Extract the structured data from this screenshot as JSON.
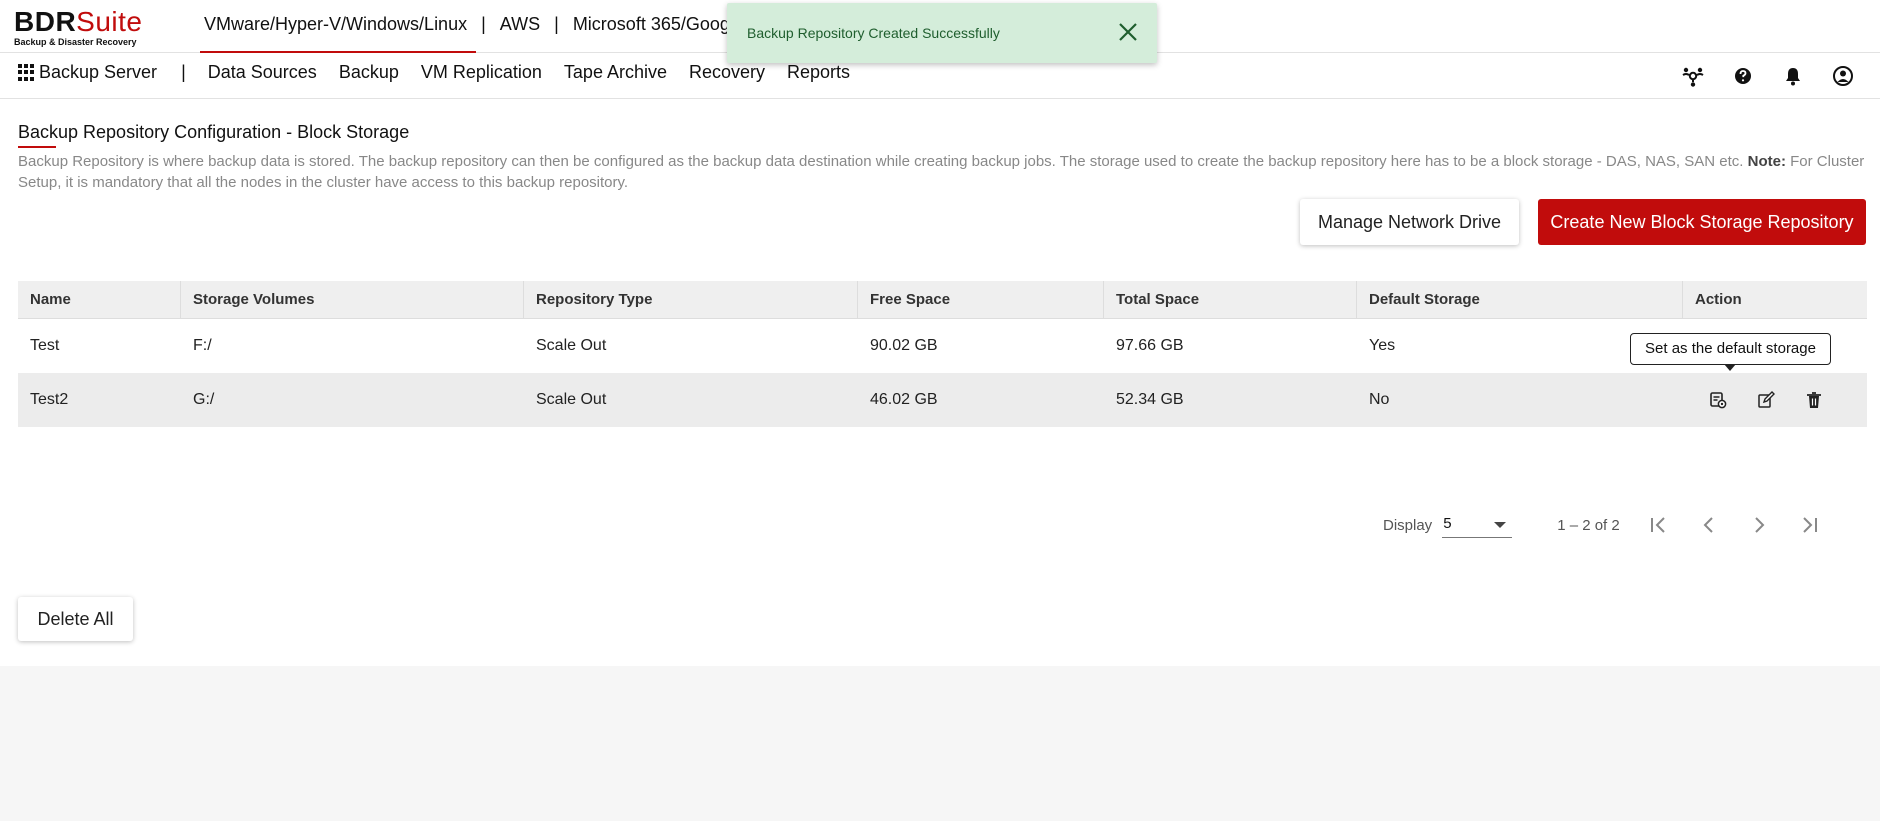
{
  "brand": {
    "name_part1": "BDR",
    "name_part2": "Suite",
    "tagline": "Backup & Disaster Recovery",
    "accent_color": "#c10c0c"
  },
  "product_tabs": [
    {
      "label": "VMware/Hyper-V/Windows/Linux",
      "active": true
    },
    {
      "label": "AWS"
    },
    {
      "label": "Microsoft 365/Goog"
    }
  ],
  "separators": {
    "pipe": "|"
  },
  "navbar": {
    "apps_icon": "grid-apps-icon",
    "server_label": "Backup Server",
    "items": [
      "Data Sources",
      "Backup",
      "VM Replication",
      "Tape Archive",
      "Recovery",
      "Reports"
    ],
    "right_icons": [
      "users-network-icon",
      "help-icon",
      "bell-icon",
      "user-account-icon"
    ]
  },
  "toast": {
    "message": "Backup Repository Created Successfully",
    "bg_color": "#d4edda"
  },
  "page": {
    "title": "Backup Repository Configuration - Block Storage",
    "description": "Backup Repository is where backup data is stored. The backup repository can then be configured as the backup data destination while creating backup jobs. The storage used to create the backup repository here has to be a block storage - DAS, NAS, SAN etc.",
    "note_label": "Note:",
    "note_text": "For Cluster Setup, it is mandatory that all the nodes in the cluster have access to this backup repository."
  },
  "buttons": {
    "manage_network_drive": "Manage Network Drive",
    "create_new": "Create New Block Storage Repository",
    "delete_all": "Delete All"
  },
  "table": {
    "columns": [
      "Name",
      "Storage Volumes",
      "Repository Type",
      "Free Space",
      "Total Space",
      "Default Storage",
      "Action"
    ],
    "rows": [
      {
        "name": "Test",
        "volume": "F:/",
        "type": "Scale Out",
        "free": "90.02 GB",
        "total": "97.66 GB",
        "default": "Yes"
      },
      {
        "name": "Test2",
        "volume": "G:/",
        "type": "Scale Out",
        "free": "46.02 GB",
        "total": "52.34 GB",
        "default": "No"
      }
    ],
    "action_icons": [
      "set-default-storage-icon",
      "edit-icon",
      "delete-icon"
    ]
  },
  "tooltip": {
    "text": "Set as the default storage"
  },
  "pagination": {
    "display_label": "Display",
    "page_size": "5",
    "range": "1 – 2 of 2"
  }
}
